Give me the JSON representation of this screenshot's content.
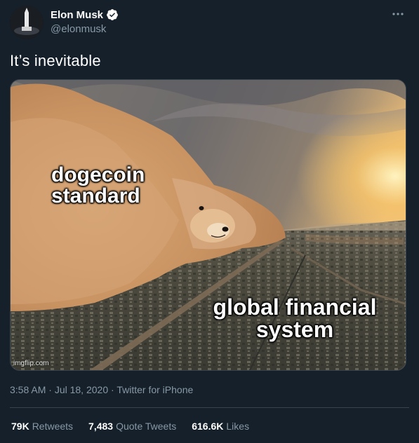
{
  "author": {
    "display_name": "Elon Musk",
    "handle": "@elonmusk",
    "verified": true
  },
  "tweet": {
    "text": "It’s inevitable",
    "media": {
      "caption_top": "dogecoin standard",
      "caption_bottom": "global financial system",
      "watermark": "imgflip.com"
    },
    "time": "3:58 AM",
    "separator": "·",
    "date": "Jul 18, 2020",
    "source": "Twitter for iPhone"
  },
  "stats": {
    "retweets_count": "79K",
    "retweets_label": "Retweets",
    "quotes_count": "7,483",
    "quotes_label": "Quote Tweets",
    "likes_count": "616.6K",
    "likes_label": "Likes"
  },
  "colors": {
    "background": "#15202b",
    "verified_blue": "#ffffff",
    "secondary_text": "#8899a6",
    "divider": "#38444d"
  },
  "icons": {
    "more": "more-options-icon",
    "verified": "verified-badge-icon"
  }
}
